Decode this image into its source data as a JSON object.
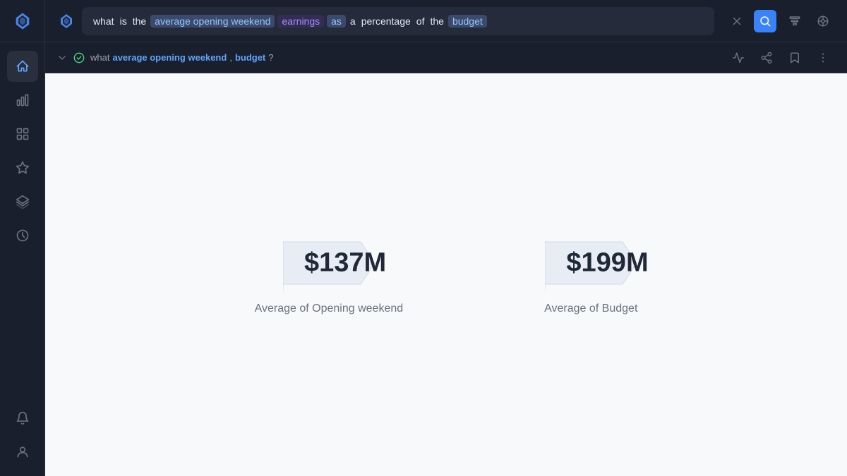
{
  "sidebar": {
    "items": [
      {
        "id": "home",
        "icon": "home-icon",
        "active": true
      },
      {
        "id": "chart",
        "icon": "chart-icon",
        "active": false
      },
      {
        "id": "grid",
        "icon": "grid-icon",
        "active": false
      },
      {
        "id": "star",
        "icon": "star-icon",
        "active": false
      },
      {
        "id": "layers",
        "icon": "layers-icon",
        "active": false
      },
      {
        "id": "history",
        "icon": "history-icon",
        "active": false
      }
    ],
    "bottom_items": [
      {
        "id": "notifications",
        "icon": "bell-icon"
      },
      {
        "id": "user",
        "icon": "user-icon"
      }
    ]
  },
  "search": {
    "tokens": [
      {
        "text": "what",
        "type": "keyword"
      },
      {
        "text": "is",
        "type": "keyword"
      },
      {
        "text": "the",
        "type": "keyword"
      },
      {
        "text": "average opening weekend",
        "type": "highlighted"
      },
      {
        "text": "earnings",
        "type": "highlighted-orange"
      },
      {
        "text": "as",
        "type": "highlighted"
      },
      {
        "text": "a",
        "type": "keyword"
      },
      {
        "text": "percentage",
        "type": "keyword"
      },
      {
        "text": "of",
        "type": "keyword"
      },
      {
        "text": "the",
        "type": "keyword"
      },
      {
        "text": "budget",
        "type": "highlighted"
      }
    ],
    "actions": {
      "clear_label": "clear",
      "search_label": "search"
    }
  },
  "query_subtitle": {
    "text_parts": [
      {
        "text": "what",
        "type": "normal"
      },
      {
        "text": "average opening weekend",
        "type": "bold"
      },
      {
        "text": ",",
        "type": "normal"
      },
      {
        "text": "budget",
        "type": "bold"
      },
      {
        "text": "?",
        "type": "question"
      }
    ]
  },
  "metrics": [
    {
      "value": "$137M",
      "label": "Average of Opening weekend",
      "id": "opening-weekend"
    },
    {
      "value": "$199M",
      "label": "Average of Budget",
      "id": "budget"
    }
  ],
  "toolbar_actions": {
    "chart_toggle": "chart-toggle",
    "share": "share",
    "bookmark": "bookmark",
    "more": "more"
  }
}
